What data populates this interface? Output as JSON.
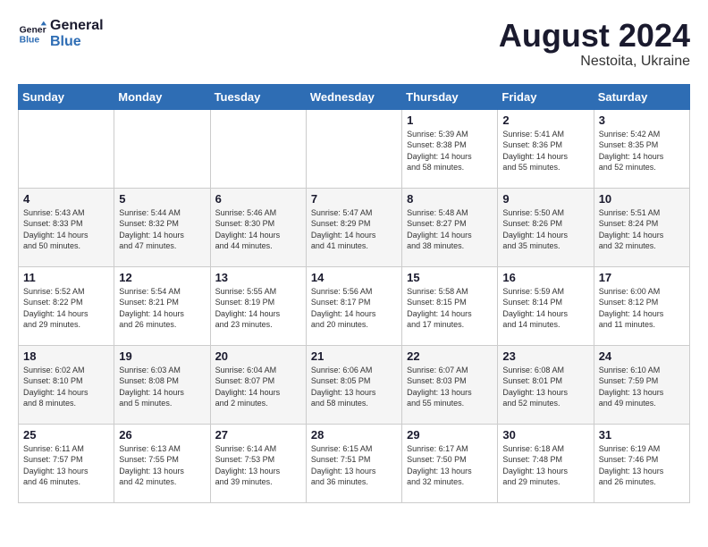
{
  "logo": {
    "text_general": "General",
    "text_blue": "Blue"
  },
  "title": {
    "month_year": "August 2024",
    "location": "Nestoita, Ukraine"
  },
  "weekdays": [
    "Sunday",
    "Monday",
    "Tuesday",
    "Wednesday",
    "Thursday",
    "Friday",
    "Saturday"
  ],
  "weeks": [
    [
      {
        "day": "",
        "info": ""
      },
      {
        "day": "",
        "info": ""
      },
      {
        "day": "",
        "info": ""
      },
      {
        "day": "",
        "info": ""
      },
      {
        "day": "1",
        "info": "Sunrise: 5:39 AM\nSunset: 8:38 PM\nDaylight: 14 hours\nand 58 minutes."
      },
      {
        "day": "2",
        "info": "Sunrise: 5:41 AM\nSunset: 8:36 PM\nDaylight: 14 hours\nand 55 minutes."
      },
      {
        "day": "3",
        "info": "Sunrise: 5:42 AM\nSunset: 8:35 PM\nDaylight: 14 hours\nand 52 minutes."
      }
    ],
    [
      {
        "day": "4",
        "info": "Sunrise: 5:43 AM\nSunset: 8:33 PM\nDaylight: 14 hours\nand 50 minutes."
      },
      {
        "day": "5",
        "info": "Sunrise: 5:44 AM\nSunset: 8:32 PM\nDaylight: 14 hours\nand 47 minutes."
      },
      {
        "day": "6",
        "info": "Sunrise: 5:46 AM\nSunset: 8:30 PM\nDaylight: 14 hours\nand 44 minutes."
      },
      {
        "day": "7",
        "info": "Sunrise: 5:47 AM\nSunset: 8:29 PM\nDaylight: 14 hours\nand 41 minutes."
      },
      {
        "day": "8",
        "info": "Sunrise: 5:48 AM\nSunset: 8:27 PM\nDaylight: 14 hours\nand 38 minutes."
      },
      {
        "day": "9",
        "info": "Sunrise: 5:50 AM\nSunset: 8:26 PM\nDaylight: 14 hours\nand 35 minutes."
      },
      {
        "day": "10",
        "info": "Sunrise: 5:51 AM\nSunset: 8:24 PM\nDaylight: 14 hours\nand 32 minutes."
      }
    ],
    [
      {
        "day": "11",
        "info": "Sunrise: 5:52 AM\nSunset: 8:22 PM\nDaylight: 14 hours\nand 29 minutes."
      },
      {
        "day": "12",
        "info": "Sunrise: 5:54 AM\nSunset: 8:21 PM\nDaylight: 14 hours\nand 26 minutes."
      },
      {
        "day": "13",
        "info": "Sunrise: 5:55 AM\nSunset: 8:19 PM\nDaylight: 14 hours\nand 23 minutes."
      },
      {
        "day": "14",
        "info": "Sunrise: 5:56 AM\nSunset: 8:17 PM\nDaylight: 14 hours\nand 20 minutes."
      },
      {
        "day": "15",
        "info": "Sunrise: 5:58 AM\nSunset: 8:15 PM\nDaylight: 14 hours\nand 17 minutes."
      },
      {
        "day": "16",
        "info": "Sunrise: 5:59 AM\nSunset: 8:14 PM\nDaylight: 14 hours\nand 14 minutes."
      },
      {
        "day": "17",
        "info": "Sunrise: 6:00 AM\nSunset: 8:12 PM\nDaylight: 14 hours\nand 11 minutes."
      }
    ],
    [
      {
        "day": "18",
        "info": "Sunrise: 6:02 AM\nSunset: 8:10 PM\nDaylight: 14 hours\nand 8 minutes."
      },
      {
        "day": "19",
        "info": "Sunrise: 6:03 AM\nSunset: 8:08 PM\nDaylight: 14 hours\nand 5 minutes."
      },
      {
        "day": "20",
        "info": "Sunrise: 6:04 AM\nSunset: 8:07 PM\nDaylight: 14 hours\nand 2 minutes."
      },
      {
        "day": "21",
        "info": "Sunrise: 6:06 AM\nSunset: 8:05 PM\nDaylight: 13 hours\nand 58 minutes."
      },
      {
        "day": "22",
        "info": "Sunrise: 6:07 AM\nSunset: 8:03 PM\nDaylight: 13 hours\nand 55 minutes."
      },
      {
        "day": "23",
        "info": "Sunrise: 6:08 AM\nSunset: 8:01 PM\nDaylight: 13 hours\nand 52 minutes."
      },
      {
        "day": "24",
        "info": "Sunrise: 6:10 AM\nSunset: 7:59 PM\nDaylight: 13 hours\nand 49 minutes."
      }
    ],
    [
      {
        "day": "25",
        "info": "Sunrise: 6:11 AM\nSunset: 7:57 PM\nDaylight: 13 hours\nand 46 minutes."
      },
      {
        "day": "26",
        "info": "Sunrise: 6:13 AM\nSunset: 7:55 PM\nDaylight: 13 hours\nand 42 minutes."
      },
      {
        "day": "27",
        "info": "Sunrise: 6:14 AM\nSunset: 7:53 PM\nDaylight: 13 hours\nand 39 minutes."
      },
      {
        "day": "28",
        "info": "Sunrise: 6:15 AM\nSunset: 7:51 PM\nDaylight: 13 hours\nand 36 minutes."
      },
      {
        "day": "29",
        "info": "Sunrise: 6:17 AM\nSunset: 7:50 PM\nDaylight: 13 hours\nand 32 minutes."
      },
      {
        "day": "30",
        "info": "Sunrise: 6:18 AM\nSunset: 7:48 PM\nDaylight: 13 hours\nand 29 minutes."
      },
      {
        "day": "31",
        "info": "Sunrise: 6:19 AM\nSunset: 7:46 PM\nDaylight: 13 hours\nand 26 minutes."
      }
    ]
  ]
}
